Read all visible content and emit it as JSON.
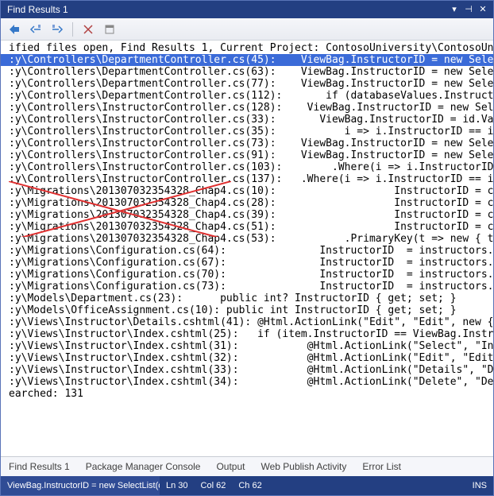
{
  "window": {
    "title": "Find Results 1"
  },
  "header_line": "ified files open, Find Results 1, Current Project: ContosoUniversity\\ContosoUniversit",
  "lines": [
    {
      "path": ":y\\Controllers\\DepartmentController.cs(45):",
      "code": "ViewBag.InstructorID = new Select",
      "sel": true
    },
    {
      "path": ":y\\Controllers\\DepartmentController.cs(63):",
      "code": "ViewBag.InstructorID = new Select"
    },
    {
      "path": ":y\\Controllers\\DepartmentController.cs(77):",
      "code": "ViewBag.InstructorID = new Select"
    },
    {
      "path": ":y\\Controllers\\DepartmentController.cs(112):",
      "code": "if (databaseValues.Instructor"
    },
    {
      "path": ":y\\Controllers\\InstructorController.cs(128):",
      "code": "ViewBag.InstructorID = new Selec"
    },
    {
      "path": ":y\\Controllers\\InstructorController.cs(33):",
      "code": "ViewBag.InstructorID = id.Valu"
    },
    {
      "path": ":y\\Controllers\\InstructorController.cs(35):",
      "code": "i => i.InstructorID == id."
    },
    {
      "path": ":y\\Controllers\\InstructorController.cs(73):",
      "code": "ViewBag.InstructorID = new Select"
    },
    {
      "path": ":y\\Controllers\\InstructorController.cs(91):",
      "code": "ViewBag.InstructorID = new Select"
    },
    {
      "path": ":y\\Controllers\\InstructorController.cs(103):",
      "code": ".Where(i => i.InstructorID ="
    },
    {
      "path": ":y\\Controllers\\InstructorController.cs(137):",
      "code": ".Where(i => i.InstructorID == id)"
    },
    {
      "path": ":y\\Migrations\\201307032354328_Chap4.cs(10):",
      "code": "InstructorID = c.I",
      "migr": true
    },
    {
      "path": ":y\\Migrations\\201307032354328_Chap4.cs(28):",
      "code": "InstructorID = c.I",
      "migr": true
    },
    {
      "path": ":y\\Migrations\\201307032354328_Chap4.cs(39):",
      "code": "InstructorID = c.I",
      "migr": true
    },
    {
      "path": ":y\\Migrations\\201307032354328_Chap4.cs(51):",
      "code": "InstructorID = c.I",
      "migr": true
    },
    {
      "path": ":y\\Migrations\\201307032354328_Chap4.cs(53):",
      "code": ".PrimaryKey(t => new { t.C",
      "migr": true
    },
    {
      "path": ":y\\Migrations\\Configuration.cs(64):",
      "code": "InstructorID  = instructors.Si"
    },
    {
      "path": ":y\\Migrations\\Configuration.cs(67):",
      "code": "InstructorID  = instructors.Si"
    },
    {
      "path": ":y\\Migrations\\Configuration.cs(70):",
      "code": "InstructorID  = instructors.Si"
    },
    {
      "path": ":y\\Migrations\\Configuration.cs(73):",
      "code": "InstructorID  = instructors.Si"
    },
    {
      "path": ":y\\Models\\Department.cs(23):",
      "code": "public int? InstructorID { get; set; }",
      "short": true
    },
    {
      "path": ":y\\Models\\OfficeAssignment.cs(10):",
      "code": "public int InstructorID { get; set; }",
      "short": true
    },
    {
      "path": ":y\\Views\\Instructor\\Details.cshtml(41):",
      "code": "@Html.ActionLink(\"Edit\", \"Edit\", new { id="
    },
    {
      "path": ":y\\Views\\Instructor\\Index.cshtml(25):",
      "code": "if (item.InstructorID == ViewBag.Instruc"
    },
    {
      "path": ":y\\Views\\Instructor\\Index.cshtml(31):",
      "code": "@Html.ActionLink(\"Select\", \"Inde"
    },
    {
      "path": ":y\\Views\\Instructor\\Index.cshtml(32):",
      "code": "@Html.ActionLink(\"Edit\", \"Edit\","
    },
    {
      "path": ":y\\Views\\Instructor\\Index.cshtml(33):",
      "code": "@Html.ActionLink(\"Details\", \"Det"
    },
    {
      "path": ":y\\Views\\Instructor\\Index.cshtml(34):",
      "code": "@Html.ActionLink(\"Delete\", \"Dele"
    }
  ],
  "footer_line": "earched: 131",
  "panes": [
    "Find Results 1",
    "Package Manager Console",
    "Output",
    "Web Publish Activity",
    "Error List"
  ],
  "status": {
    "current": "ViewBag.InstructorID = new SelectList(db....",
    "ln": "Ln 30",
    "col": "Col 62",
    "ch": "Ch 62",
    "ins": "INS"
  }
}
